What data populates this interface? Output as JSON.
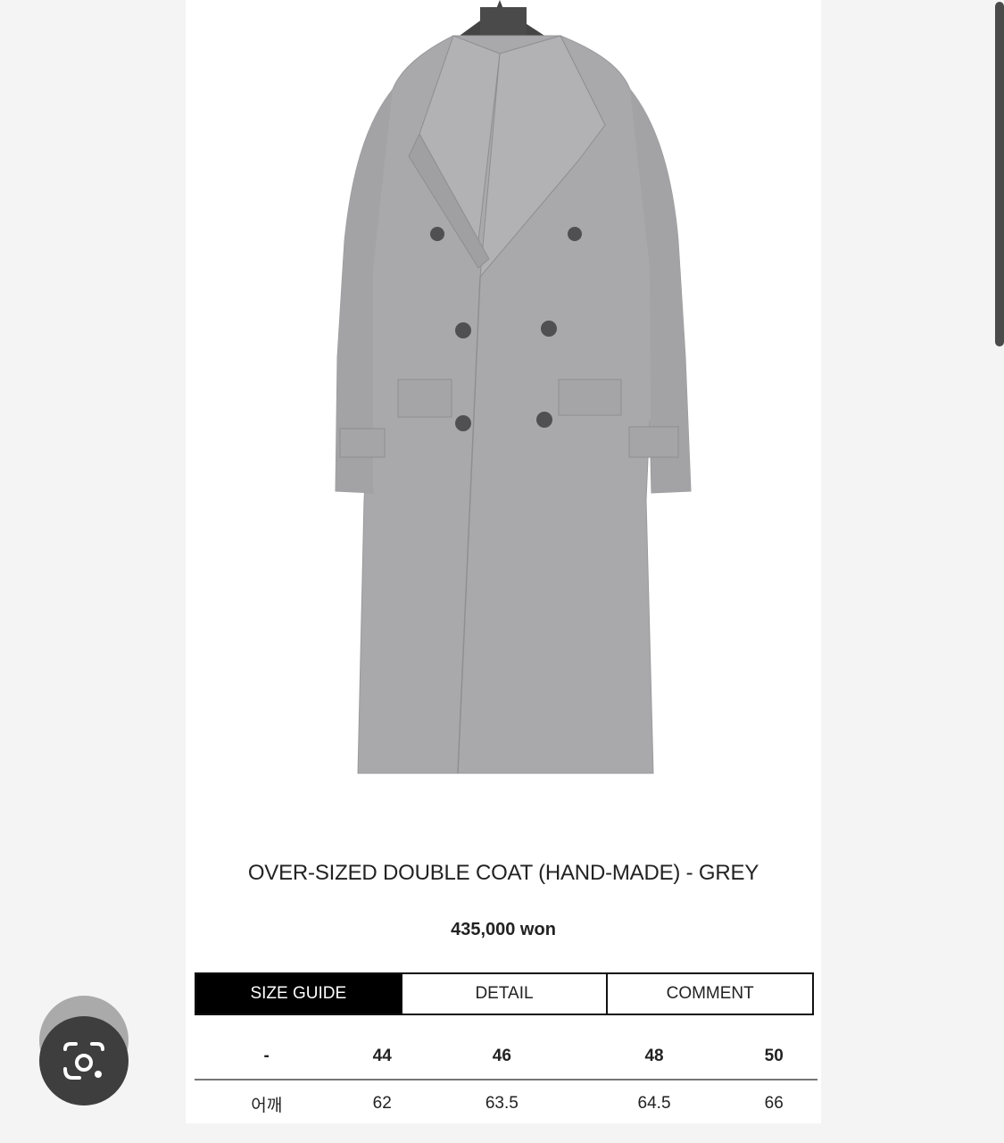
{
  "product": {
    "title": "OVER-SIZED DOUBLE COAT (HAND-MADE) - GREY",
    "price": "435,000 won",
    "image_alt": "grey double-breasted oversized coat on hanger",
    "color": "#a9a9ab"
  },
  "tabs": [
    {
      "label": "SIZE GUIDE",
      "active": true
    },
    {
      "label": "DETAIL",
      "active": false
    },
    {
      "label": "COMMENT",
      "active": false
    }
  ],
  "size_table": {
    "headers": [
      "-",
      "44",
      "46",
      "48",
      "50"
    ],
    "rows": [
      [
        "어깨",
        "62",
        "63.5",
        "64.5",
        "66"
      ]
    ]
  },
  "overlay": {
    "lens_button_icon": "lens-camera-icon"
  },
  "theme": {
    "active_tab_bg": "#000000",
    "page_bg": "#f4f4f5"
  }
}
